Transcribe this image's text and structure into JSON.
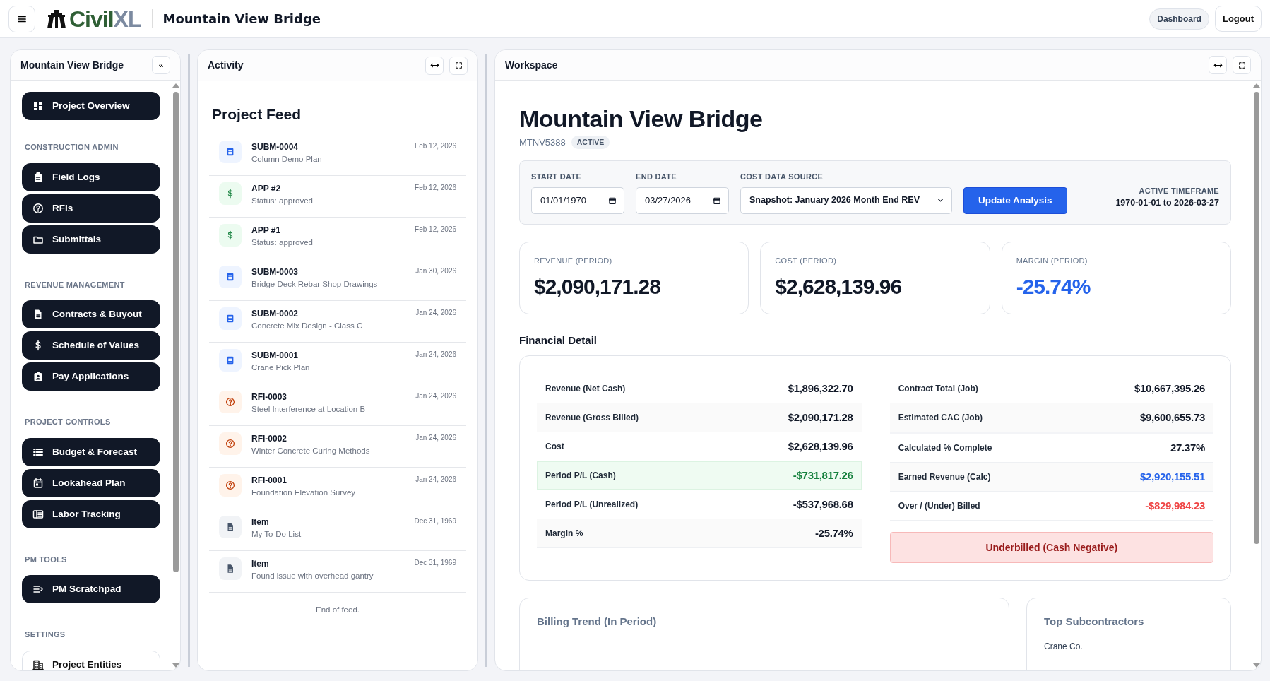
{
  "header": {
    "logo_primary": "Civil",
    "logo_secondary": "XL",
    "project_title": "Mountain View Bridge",
    "buttons": [
      {
        "label": "Dashboard",
        "kind": "pill"
      },
      {
        "label": "Logout",
        "kind": "outline"
      }
    ]
  },
  "sidebar": {
    "title": "Mountain View Bridge",
    "collapse_glyph": "«",
    "sections": [
      {
        "items": [
          {
            "label": "Project Overview",
            "kind": "filled"
          }
        ]
      },
      {
        "heading": "CONSTRUCTION ADMIN",
        "items": [
          {
            "label": "Field Logs",
            "kind": "filled"
          },
          {
            "label": "RFIs",
            "kind": "filled"
          },
          {
            "label": "Submittals",
            "kind": "filled"
          }
        ]
      },
      {
        "heading": "REVENUE MANAGEMENT",
        "items": [
          {
            "label": "Contracts & Buyout",
            "kind": "filled"
          },
          {
            "label": "Schedule of Values",
            "kind": "filled"
          },
          {
            "label": "Pay Applications",
            "kind": "filled"
          }
        ]
      },
      {
        "heading": "PROJECT CONTROLS",
        "items": [
          {
            "label": "Budget & Forecast",
            "kind": "filled"
          },
          {
            "label": "Lookahead Plan",
            "kind": "filled"
          },
          {
            "label": "Labor Tracking",
            "kind": "filled"
          }
        ]
      },
      {
        "heading": "PM TOOLS",
        "items": [
          {
            "label": "PM Scratchpad",
            "kind": "filled"
          }
        ]
      },
      {
        "heading": "SETTINGS",
        "items": [
          {
            "label": "Project Entities",
            "kind": "outline"
          }
        ]
      }
    ]
  },
  "activity": {
    "title": "Activity",
    "heading": "Project Feed",
    "items": [
      {
        "kind": "submittal",
        "title": "SUBM-0004",
        "subtitle": "Column Demo Plan",
        "date": "Feb 12, 2026"
      },
      {
        "kind": "payment",
        "title": "APP #2",
        "subtitle": "Status: approved",
        "date": "Feb 12, 2026"
      },
      {
        "kind": "payment",
        "title": "APP #1",
        "subtitle": "Status: approved",
        "date": "Feb 12, 2026"
      },
      {
        "kind": "submittal",
        "title": "SUBM-0003",
        "subtitle": "Bridge Deck Rebar Shop Drawings",
        "date": "Jan 30, 2026"
      },
      {
        "kind": "submittal",
        "title": "SUBM-0002",
        "subtitle": "Concrete Mix Design - Class C",
        "date": "Jan 24, 2026"
      },
      {
        "kind": "submittal",
        "title": "SUBM-0001",
        "subtitle": "Crane Pick Plan",
        "date": "Jan 24, 2026"
      },
      {
        "kind": "rfi",
        "title": "RFI-0003",
        "subtitle": "Steel Interference at Location B",
        "date": "Jan 24, 2026"
      },
      {
        "kind": "rfi",
        "title": "RFI-0002",
        "subtitle": "Winter Concrete Curing Methods",
        "date": "Jan 24, 2026"
      },
      {
        "kind": "rfi",
        "title": "RFI-0001",
        "subtitle": "Foundation Elevation Survey",
        "date": "Jan 24, 2026"
      },
      {
        "kind": "item",
        "title": "Item",
        "subtitle": "My To-Do List",
        "date": "Dec 31, 1969"
      },
      {
        "kind": "item",
        "title": "Item",
        "subtitle": "Found issue with overhead gantry",
        "date": "Dec 31, 1969"
      }
    ],
    "footer": "End of feed."
  },
  "workspace": {
    "title": "Workspace",
    "project_name": "Mountain View Bridge",
    "project_code": "MTNV5388",
    "status": "ACTIVE",
    "filters": {
      "start_date": {
        "label": "START DATE",
        "value": "01/01/1970"
      },
      "end_date": {
        "label": "END DATE",
        "value": "03/27/2026"
      },
      "cost_source": {
        "label": "COST DATA SOURCE",
        "value": "Snapshot: January 2026 Month End REV"
      },
      "button": "Update Analysis",
      "timeframe_label": "ACTIVE TIMEFRAME",
      "timeframe_value": "1970-01-01 to 2026-03-27"
    },
    "kpis": [
      {
        "label": "REVENUE (PERIOD)",
        "value": "$2,090,171.28",
        "color": "#111827"
      },
      {
        "label": "COST (PERIOD)",
        "value": "$2,628,139.96",
        "color": "#111827"
      },
      {
        "label": "MARGIN (PERIOD)",
        "value": "-25.74%",
        "color": "#2563eb"
      }
    ],
    "financial_detail": {
      "title": "Financial Detail",
      "left_rows": [
        {
          "label": "Revenue (Net Cash)",
          "value": "$1,896,322.70",
          "color": "#111827",
          "highlighted": false
        },
        {
          "label": "Revenue (Gross Billed)",
          "value": "$2,090,171.28",
          "color": "#111827",
          "highlighted": false
        },
        {
          "label": "Cost",
          "value": "$2,628,139.96",
          "color": "#111827",
          "highlighted": false
        },
        {
          "label": "Period P/L (Cash)",
          "value": "-$731,817.26",
          "color": "#15803d",
          "highlighted": true
        },
        {
          "label": "Period P/L (Unrealized)",
          "value": "-$537,968.68",
          "color": "#111827",
          "highlighted": false
        },
        {
          "label": "Margin %",
          "value": "-25.74%",
          "color": "#111827",
          "highlighted": false
        }
      ],
      "right_rows": [
        {
          "label": "Contract Total (Job)",
          "value": "$10,667,395.26",
          "color": "#111827",
          "highlighted": false
        },
        {
          "label": "Estimated CAC (Job)",
          "value": "$9,600,655.73",
          "color": "#111827",
          "highlighted": false
        },
        {
          "label": "Calculated % Complete",
          "value": "27.37%",
          "color": "#111827",
          "highlighted": false
        },
        {
          "label": "Earned Revenue (Calc)",
          "value": "$2,920,155.51",
          "color": "#2563eb",
          "highlighted": false
        },
        {
          "label": "Over / (Under) Billed",
          "value": "-$829,984.23",
          "color": "#ef4444",
          "highlighted": false
        }
      ],
      "alert": "Underbilled (Cash Negative)"
    },
    "billing_trend": {
      "title": "Billing Trend (In Period)"
    },
    "top_subcontractors": {
      "title": "Top Subcontractors",
      "items": [
        "Crane Co."
      ]
    }
  }
}
